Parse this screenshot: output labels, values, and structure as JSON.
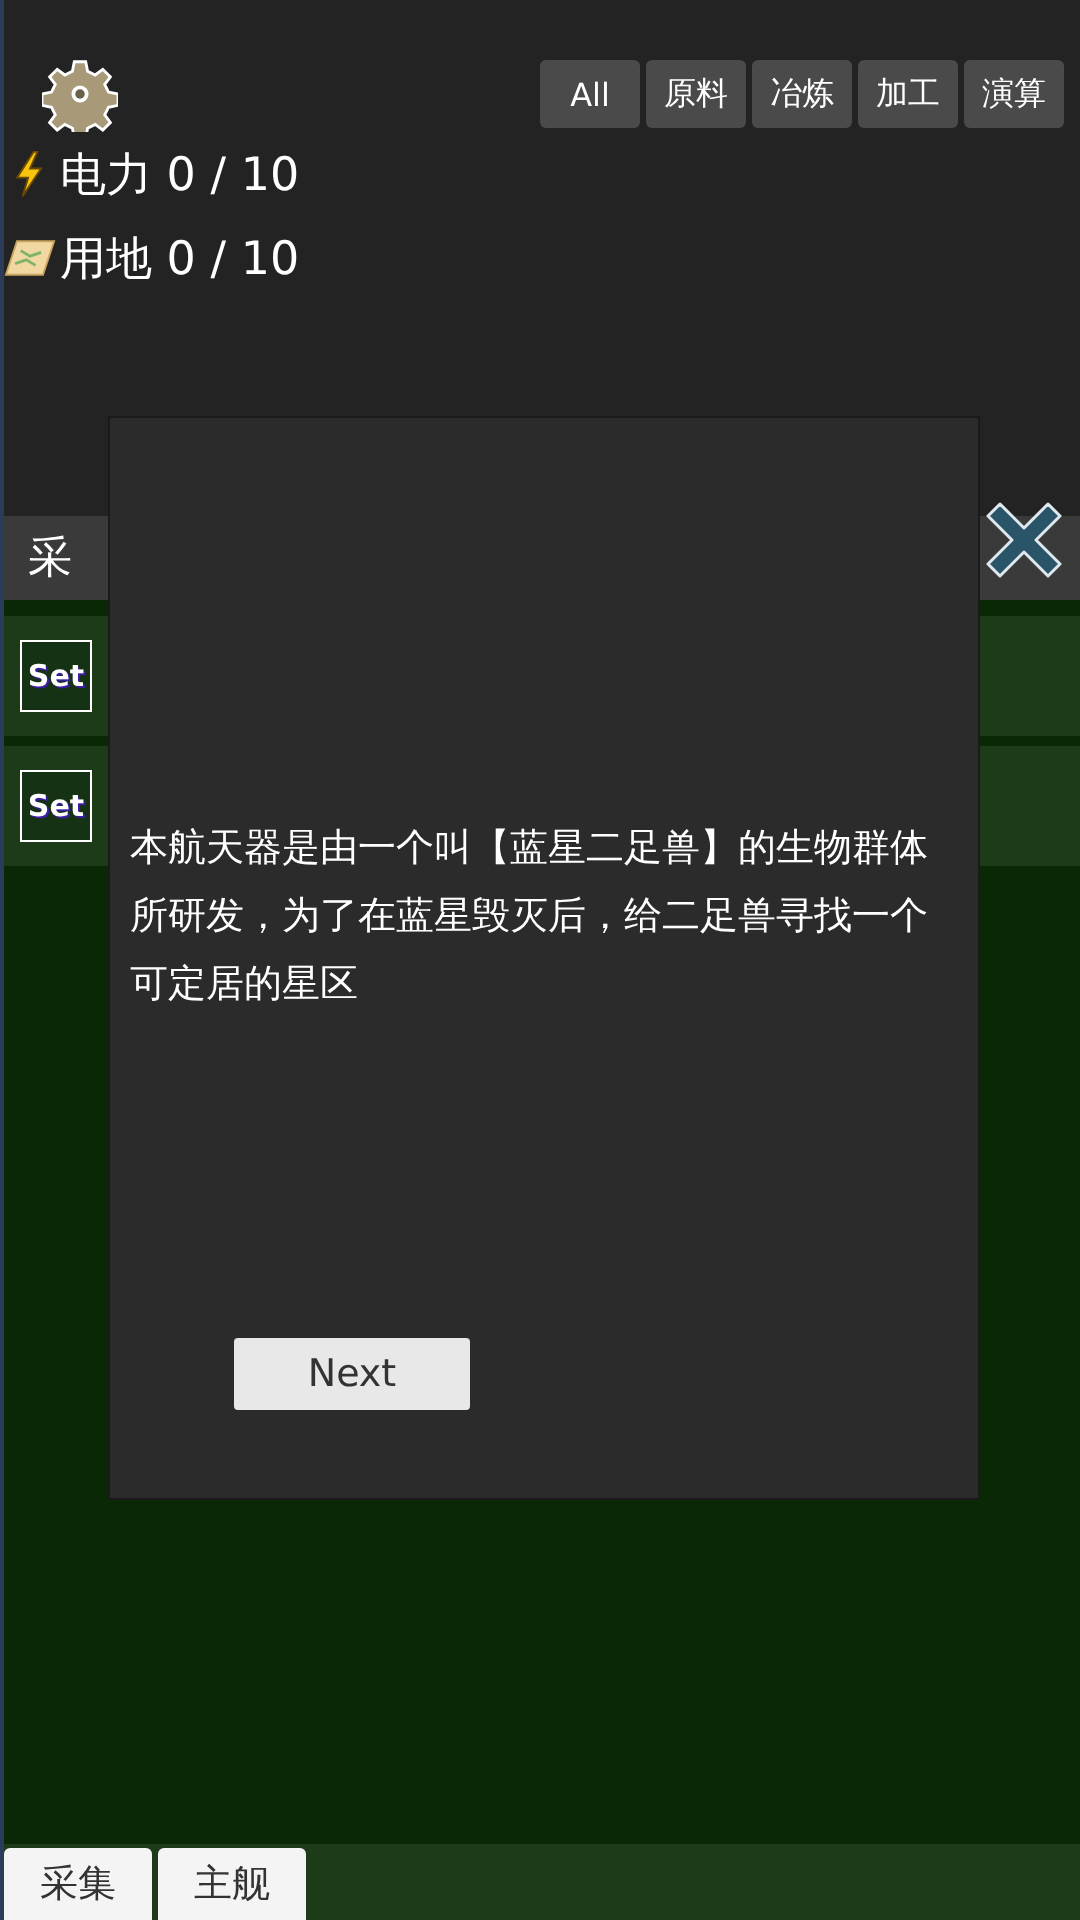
{
  "stats": [
    {
      "kind": "power",
      "label": "电力 0 / 10"
    },
    {
      "kind": "land",
      "label": "用地 0 / 10"
    }
  ],
  "filters": [
    "All",
    "原料",
    "冶炼",
    "加工",
    "演算"
  ],
  "section": {
    "title": "采"
  },
  "rows": [
    {
      "button": "Set"
    },
    {
      "button": "Set"
    }
  ],
  "dialog": {
    "text": "本航天器是由一个叫【蓝星二足兽】的生物群体所研发，为了在蓝星毁灭后，给二足兽寻找一个可定居的星区",
    "button": "Next"
  },
  "bottom_tabs": [
    "采集",
    "主舰"
  ]
}
